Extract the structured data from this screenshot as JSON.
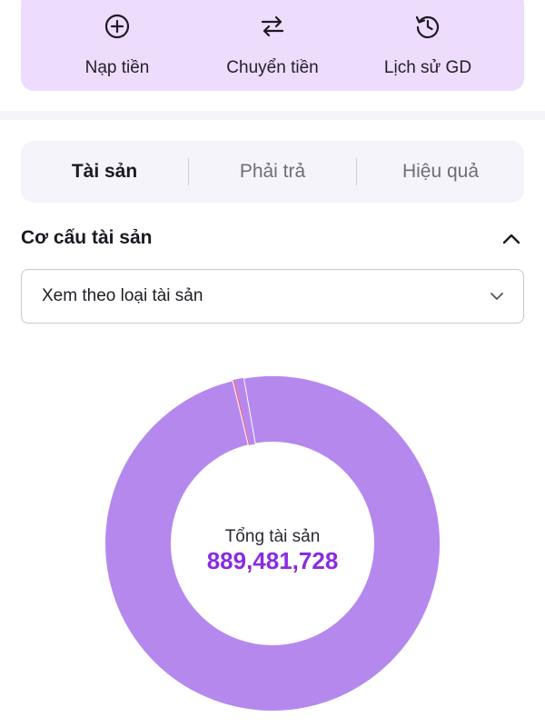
{
  "quick_actions": [
    {
      "label": "Nạp tiền",
      "icon": "plus-circle-icon"
    },
    {
      "label": "Chuyển tiền",
      "icon": "transfer-arrows-icon"
    },
    {
      "label": "Lịch sử GD",
      "icon": "history-clock-icon"
    }
  ],
  "tabs": [
    {
      "label": "Tài sản",
      "active": true
    },
    {
      "label": "Phải trả",
      "active": false
    },
    {
      "label": "Hiệu quả",
      "active": false
    }
  ],
  "section": {
    "title": "Cơ cấu tài sản",
    "collapse_icon": "chevron-up-icon"
  },
  "view_select": {
    "value": "Xem theo loại tài sản",
    "icon": "chevron-down-icon"
  },
  "donut": {
    "center_label": "Tổng tài sản",
    "center_value": "889,481,728",
    "slices": [
      {
        "share": 0.99,
        "color": "#b588ee"
      },
      {
        "share": 0.002,
        "color": "#e06fa0"
      },
      {
        "share": 0.008,
        "color": "#b588ee"
      }
    ]
  },
  "colors": {
    "accent": "#8a2be2",
    "panel": "#eddcfb",
    "donut_main": "#b588ee"
  }
}
